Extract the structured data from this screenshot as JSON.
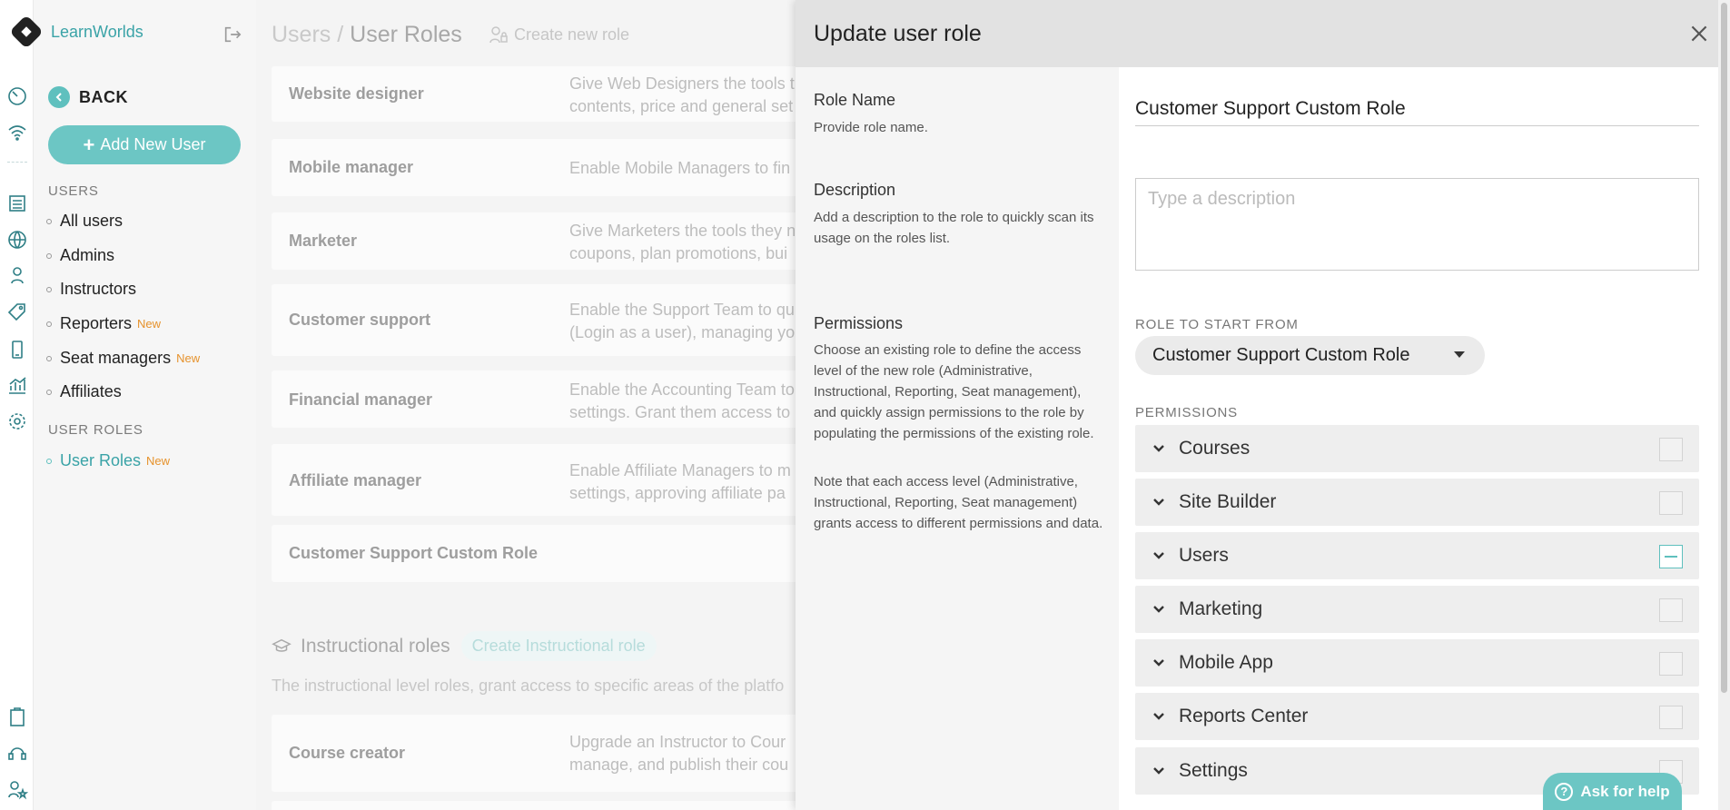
{
  "brand": {
    "name": "LearnWorlds",
    "accent": "#6cc6c4",
    "teal_text": "#3aa3a7",
    "new_badge_color": "#e6922c"
  },
  "sidebar": {
    "back_label": "BACK",
    "add_user_label": "Add New User",
    "users_section": "USERS",
    "items": [
      {
        "label": "All users",
        "badge": ""
      },
      {
        "label": "Admins",
        "badge": ""
      },
      {
        "label": "Instructors",
        "badge": ""
      },
      {
        "label": "Reporters",
        "badge": "New"
      },
      {
        "label": "Seat managers",
        "badge": "New"
      },
      {
        "label": "Affiliates",
        "badge": ""
      }
    ],
    "roles_section": "USER ROLES",
    "role_items": [
      {
        "label": "User Roles",
        "badge": "New",
        "active": true
      }
    ]
  },
  "main": {
    "breadcrumb_parent": "Users",
    "breadcrumb_sep": " / ",
    "breadcrumb_current": "User Roles",
    "create_role_label": "Create new role",
    "roles": [
      {
        "name": "Website designer",
        "desc1": "Give Web Designers the tools t",
        "desc2": "contents, price and general set"
      },
      {
        "name": "Mobile manager",
        "desc1": "Enable Mobile Managers to fin",
        "desc2": ""
      },
      {
        "name": "Marketer",
        "desc1": "Give Marketers the tools they n",
        "desc2": "coupons, plan promotions, bui"
      },
      {
        "name": "Customer support",
        "desc1": "Enable the Support Team to qu",
        "desc2": "(Login as a user), managing yo"
      },
      {
        "name": "Financial manager",
        "desc1": "Enable the Accounting Team to",
        "desc2": "settings. Grant them access to"
      },
      {
        "name": "Affiliate manager",
        "desc1": "Enable Affiliate Managers to m",
        "desc2": "settings, approving affiliate pa"
      },
      {
        "name": "Customer Support Custom Role",
        "desc1": "",
        "desc2": ""
      }
    ],
    "instructional_title": "Instructional roles",
    "instructional_button": "Create Instructional role",
    "instructional_desc": "The instructional level roles, grant access to specific areas of the platfo",
    "instr_roles": [
      {
        "name": "Course creator",
        "desc1": "Upgrade an Instructor to Cour",
        "desc2": "manage, and publish their cou"
      }
    ]
  },
  "panel": {
    "title": "Update user role",
    "role_name_title": "Role Name",
    "role_name_help": "Provide role name.",
    "role_name_value": "Customer Support Custom Role",
    "description_title": "Description",
    "description_help": "Add a description to the role to quickly scan its usage on the roles list.",
    "description_placeholder": "Type a description",
    "permissions_title": "Permissions",
    "permissions_help1": "Choose an existing role to define the access level of the new role (Administrative, Instructional, Reporting, Seat management), and quickly assign permissions to the role by populating the permissions of the existing role.",
    "permissions_help2": "Note that each access level (Administrative, Instructional, Reporting, Seat management) grants access to different permissions and data.",
    "start_from_label": "ROLE TO START FROM",
    "start_from_value": "Customer Support Custom Role",
    "permissions_label": "PERMISSIONS",
    "permission_groups": [
      {
        "label": "Courses",
        "state": "none"
      },
      {
        "label": "Site Builder",
        "state": "none"
      },
      {
        "label": "Users",
        "state": "partial"
      },
      {
        "label": "Marketing",
        "state": "none"
      },
      {
        "label": "Mobile App",
        "state": "none"
      },
      {
        "label": "Reports Center",
        "state": "none"
      },
      {
        "label": "Settings",
        "state": "none"
      }
    ]
  },
  "help_button": "Ask for help"
}
